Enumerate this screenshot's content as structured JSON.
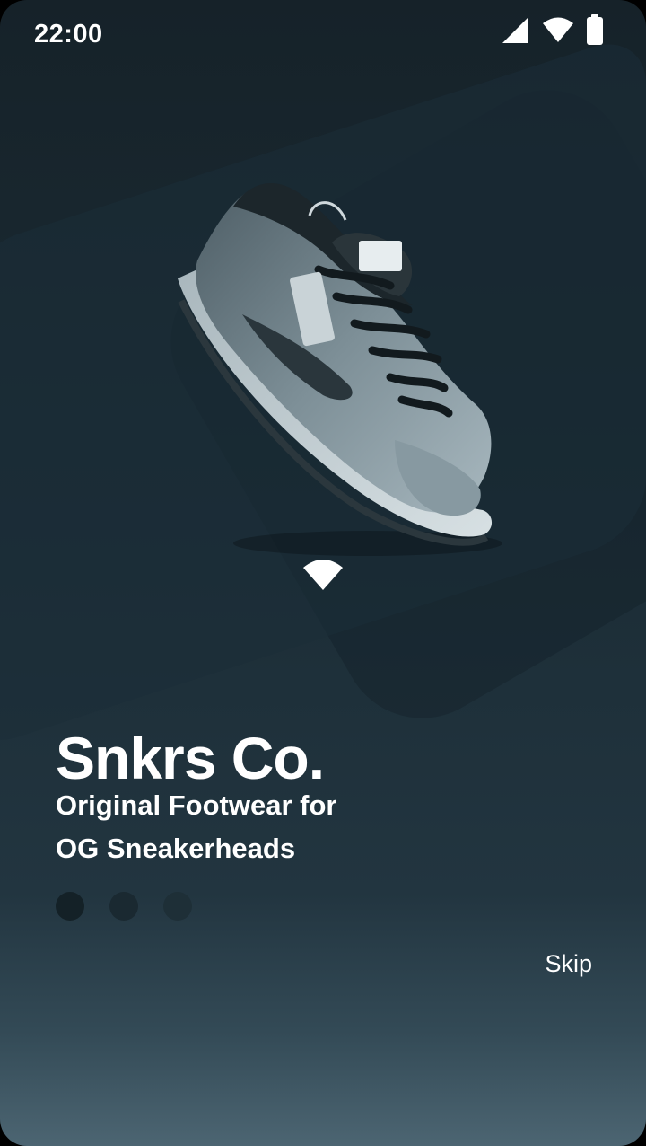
{
  "status_bar": {
    "time": "22:00",
    "icons": [
      "cell-signal-icon",
      "wifi-icon",
      "battery-icon"
    ]
  },
  "onboarding": {
    "hero_image": "sneaker-image",
    "brand": "Snkrs Co.",
    "tagline_line1": "Original Footwear for",
    "tagline_line2": "OG Sneakerheads",
    "page_indicator": {
      "total": 3,
      "current": 1
    },
    "skip_label": "Skip"
  },
  "colors": {
    "background_top": "#162229",
    "background_bottom": "#4c6572",
    "dot": "#142127",
    "dot_dim": "#1e2f37",
    "text": "#ffffff"
  }
}
